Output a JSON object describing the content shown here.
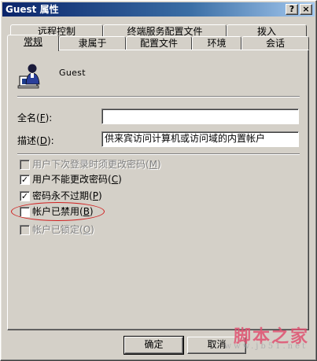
{
  "window": {
    "title": "Guest 属性",
    "help_glyph": "?",
    "close_glyph": "×"
  },
  "tabs_back": [
    "远程控制",
    "终端服务配置文件",
    "拨入"
  ],
  "tabs_front": [
    "常规",
    "隶属于",
    "配置文件",
    "环境",
    "会话"
  ],
  "active_tab": "常规",
  "user": {
    "icon": "user-account-icon",
    "name": "Guest"
  },
  "fields": {
    "fullname": {
      "label": "全名(",
      "mnemonic": "F",
      "suffix": "):",
      "value": ""
    },
    "description": {
      "label": "描述(",
      "mnemonic": "D",
      "suffix": "):",
      "value": "供来宾访问计算机或访问域的内置帐户"
    }
  },
  "checkboxes": [
    {
      "label": "用户下次登录时须更改密码(",
      "mnemonic": "M",
      "suffix": ")",
      "checked": false,
      "enabled": false
    },
    {
      "label": "用户不能更改密码(",
      "mnemonic": "C",
      "suffix": ")",
      "checked": true,
      "enabled": true
    },
    {
      "label": "密码永不过期(",
      "mnemonic": "P",
      "suffix": ")",
      "checked": true,
      "enabled": true
    },
    {
      "label": "帐户已禁用(",
      "mnemonic": "B",
      "suffix": ")",
      "checked": false,
      "enabled": true
    },
    {
      "label": "帐户已锁定(",
      "mnemonic": "O",
      "suffix": ")",
      "checked": false,
      "enabled": false
    }
  ],
  "buttons": {
    "ok": "确定",
    "cancel": "取消"
  },
  "watermark": {
    "main": "脚本之家",
    "url": "www.jb51.net"
  },
  "colors": {
    "title_bar": "#0a246a",
    "highlight": "#d02020",
    "watermark": "#e05070"
  }
}
